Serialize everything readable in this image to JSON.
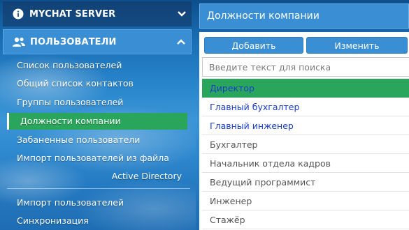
{
  "sidebar": {
    "server_section": {
      "title": "MYCHAT SERVER",
      "icon": "info-icon",
      "chevron": "chevron-down-icon"
    },
    "users_section": {
      "title": "ПОЛЬЗОВАТЕЛИ",
      "icon": "users-icon",
      "chevron": "chevron-up-icon"
    },
    "items": [
      {
        "label": "Список пользователей"
      },
      {
        "label": "Общий список контактов"
      },
      {
        "label": "Группы пользователей"
      },
      {
        "label": "Должности компании",
        "active": true
      },
      {
        "label": "Забаненные пользователи"
      },
      {
        "label": "Импорт пользователей из файла"
      }
    ],
    "ad_heading": "Active Directory",
    "ad_items": [
      {
        "label": "Импорт пользователей"
      },
      {
        "label": "Синхронизация"
      }
    ]
  },
  "panel": {
    "title": "Должности компании",
    "buttons": {
      "add": "Добавить",
      "edit": "Изменить"
    },
    "search": {
      "placeholder": "Введите текст для поиска",
      "value": ""
    },
    "positions": [
      {
        "name": "Директор",
        "state": "selected"
      },
      {
        "name": "Главный бухгалтер",
        "state": "blue"
      },
      {
        "name": "Главный инженер",
        "state": "blue"
      },
      {
        "name": "Бухгалтер",
        "state": "gray"
      },
      {
        "name": "Начальник отдела кадров",
        "state": "gray"
      },
      {
        "name": "Ведущий программист",
        "state": "gray"
      },
      {
        "name": "Инженер",
        "state": "gray"
      },
      {
        "name": "Стажёр",
        "state": "gray"
      }
    ]
  },
  "colors": {
    "accent_blue": "#3a8fd4",
    "active_green": "#2aa65c",
    "link_blue": "#1a3cc9"
  }
}
